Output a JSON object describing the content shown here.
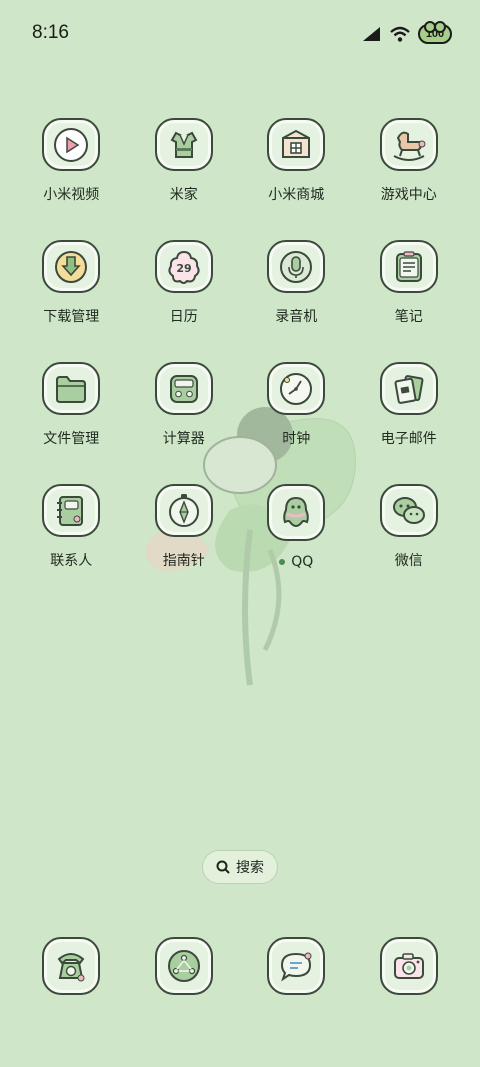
{
  "status_bar": {
    "time": "8:16",
    "battery_level": "100",
    "icons": [
      "signal-icon",
      "wifi-icon",
      "battery-icon"
    ]
  },
  "apps": [
    {
      "label": "小米视频",
      "icon": "video-play-icon"
    },
    {
      "label": "米家",
      "icon": "clothing-icon"
    },
    {
      "label": "小米商城",
      "icon": "shop-box-icon"
    },
    {
      "label": "游戏中心",
      "icon": "rocking-horse-icon"
    },
    {
      "label": "下载管理",
      "icon": "download-arrow-icon"
    },
    {
      "label": "日历",
      "icon": "calendar-flower-icon",
      "date": "29"
    },
    {
      "label": "录音机",
      "icon": "microphone-icon"
    },
    {
      "label": "笔记",
      "icon": "notepad-icon"
    },
    {
      "label": "文件管理",
      "icon": "folder-icon"
    },
    {
      "label": "计算器",
      "icon": "calculator-icon"
    },
    {
      "label": "时钟",
      "icon": "clock-icon"
    },
    {
      "label": "电子邮件",
      "icon": "mail-cards-icon"
    },
    {
      "label": "联系人",
      "icon": "contacts-book-icon"
    },
    {
      "label": "指南针",
      "icon": "compass-icon"
    },
    {
      "label": "QQ",
      "icon": "qq-penguin-icon",
      "has_update_dot": true
    },
    {
      "label": "微信",
      "icon": "wechat-bubbles-icon"
    }
  ],
  "search": {
    "label": "搜索",
    "icon": "search-icon"
  },
  "dock": [
    {
      "icon": "telephone-icon"
    },
    {
      "icon": "browser-share-icon"
    },
    {
      "icon": "messages-bubble-icon"
    },
    {
      "icon": "camera-icon"
    }
  ],
  "colors": {
    "background": "#cfe6c9",
    "icon_tile": "#e6f2e1",
    "outline": "#3c4a3c",
    "accent_green": "#8fbf82",
    "accent_pink": "#f2b7c4"
  }
}
